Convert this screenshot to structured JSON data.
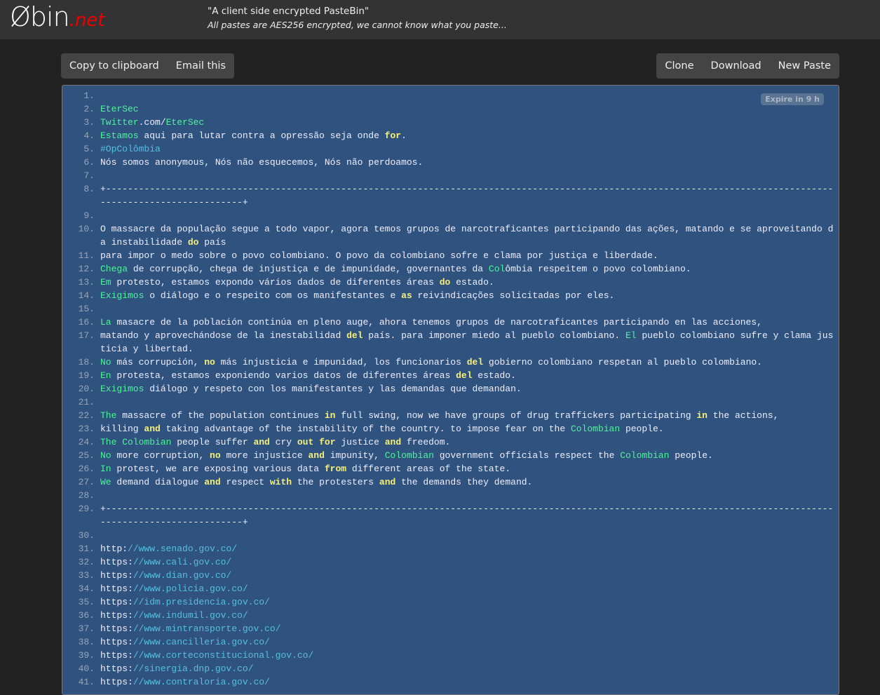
{
  "header": {
    "logo_main": "Øbin",
    "logo_tld": ".net",
    "tagline": "\"A client side encrypted PasteBin\"",
    "subtitle": "All pastes are AES256 encrypted, we cannot know what you paste..."
  },
  "toolbar_left": [
    "Copy to clipboard",
    "Email this"
  ],
  "toolbar_right": [
    "Clone",
    "Download",
    "New Paste"
  ],
  "paste": {
    "expire_badge": "Expire in 9 h",
    "lines": [
      [],
      [
        [
          "EterSec",
          "g"
        ]
      ],
      [
        [
          "Twitter",
          "g"
        ],
        [
          ".com/",
          ""
        ],
        [
          "EterSec",
          "g"
        ]
      ],
      [
        [
          "Estamos",
          "g"
        ],
        [
          " aqui para lutar contra a opressão seja onde ",
          ""
        ],
        [
          "for",
          "y"
        ],
        [
          ".",
          ""
        ]
      ],
      [
        [
          "#OpColômbia",
          "c"
        ]
      ],
      [
        [
          "Nós somos anonymous, Nós não esquecemos, Nós não perdoamos.",
          ""
        ]
      ],
      [],
      [
        [
          "+---------------------------------------------------------------------------------------------------------------------------------------------------------------+",
          ""
        ]
      ],
      [],
      [
        [
          "O massacre da população segue a todo vapor, agora temos grupos de narcotraficantes participando das ações, matando e se aproveitando da instabilidade ",
          ""
        ],
        [
          "do",
          "y"
        ],
        [
          " país",
          ""
        ]
      ],
      [
        [
          "para impor o medo sobre o povo colombiano. O povo da colombiano sofre e clama por justiça e liberdade.",
          ""
        ]
      ],
      [
        [
          "Chega",
          "g"
        ],
        [
          " de corrupção, chega de injustiça e de impunidade, governantes da ",
          ""
        ],
        [
          "Col",
          "g"
        ],
        [
          "ômbia respeitem o povo colombiano.",
          ""
        ]
      ],
      [
        [
          "Em",
          "g"
        ],
        [
          " protesto, estamos expondo vários dados de diferentes áreas ",
          ""
        ],
        [
          "do",
          "y"
        ],
        [
          " estado.",
          ""
        ]
      ],
      [
        [
          "Exigimos",
          "g"
        ],
        [
          " o diálogo e o respeito com os manifestantes e ",
          ""
        ],
        [
          "as",
          "y"
        ],
        [
          " reivindicações solicitadas por eles.",
          ""
        ]
      ],
      [],
      [
        [
          "La",
          "g"
        ],
        [
          " masacre de la población continúa en pleno auge, ahora tenemos grupos de narcotraficantes participando en las acciones,",
          ""
        ]
      ],
      [
        [
          "matando y aprovechándose de la inestabilidad ",
          ""
        ],
        [
          "del",
          "y"
        ],
        [
          " país. para imponer miedo al pueblo colombiano. ",
          ""
        ],
        [
          "El",
          "g"
        ],
        [
          " pueblo colombiano sufre y clama justicia y libertad.",
          ""
        ]
      ],
      [
        [
          "No",
          "g"
        ],
        [
          " más corrupción, ",
          ""
        ],
        [
          "no",
          "y"
        ],
        [
          " más injusticia e impunidad, los funcionarios ",
          ""
        ],
        [
          "del",
          "y"
        ],
        [
          " gobierno colombiano respetan al pueblo colombiano.",
          ""
        ]
      ],
      [
        [
          "En",
          "g"
        ],
        [
          " protesta, estamos exponiendo varios datos de diferentes áreas ",
          ""
        ],
        [
          "del",
          "y"
        ],
        [
          " estado.",
          ""
        ]
      ],
      [
        [
          "Exigimos",
          "g"
        ],
        [
          " diálogo y respeto con los manifestantes y las demandas que demandan.",
          ""
        ]
      ],
      [],
      [
        [
          "The",
          "g"
        ],
        [
          " massacre of the population continues ",
          ""
        ],
        [
          "in",
          "y"
        ],
        [
          " full swing, now we have groups of drug traffickers participating ",
          ""
        ],
        [
          "in",
          "y"
        ],
        [
          " the actions,",
          ""
        ]
      ],
      [
        [
          "killing ",
          ""
        ],
        [
          "and",
          "y"
        ],
        [
          " taking advantage of the instability of the country. to impose fear on the ",
          ""
        ],
        [
          "Colombian",
          "g"
        ],
        [
          " people.",
          ""
        ]
      ],
      [
        [
          "The Colombian",
          "g"
        ],
        [
          " people suffer ",
          ""
        ],
        [
          "and",
          "y"
        ],
        [
          " cry ",
          ""
        ],
        [
          "out",
          "y"
        ],
        [
          " ",
          ""
        ],
        [
          "for",
          "y"
        ],
        [
          " justice ",
          ""
        ],
        [
          "and",
          "y"
        ],
        [
          " freedom.",
          ""
        ]
      ],
      [
        [
          "No",
          "g"
        ],
        [
          " more corruption, ",
          ""
        ],
        [
          "no",
          "y"
        ],
        [
          " more injustice ",
          ""
        ],
        [
          "and",
          "y"
        ],
        [
          " impunity, ",
          ""
        ],
        [
          "Colombian",
          "g"
        ],
        [
          " government officials respect the ",
          ""
        ],
        [
          "Colombian",
          "g"
        ],
        [
          " people.",
          ""
        ]
      ],
      [
        [
          "In",
          "g"
        ],
        [
          " protest, we are exposing various data ",
          ""
        ],
        [
          "from",
          "y"
        ],
        [
          " different areas of the state.",
          ""
        ]
      ],
      [
        [
          "We",
          "g"
        ],
        [
          " demand dialogue ",
          ""
        ],
        [
          "and",
          "y"
        ],
        [
          " respect ",
          ""
        ],
        [
          "with",
          "y"
        ],
        [
          " the protesters ",
          ""
        ],
        [
          "and",
          "y"
        ],
        [
          " the demands they demand.",
          ""
        ]
      ],
      [],
      [
        [
          "+---------------------------------------------------------------------------------------------------------------------------------------------------------------+",
          ""
        ]
      ],
      [],
      [
        [
          "http:",
          ""
        ],
        [
          "//www.senado.gov.co/",
          "c"
        ]
      ],
      [
        [
          "https:",
          ""
        ],
        [
          "//www.cali.gov.co/",
          "c"
        ]
      ],
      [
        [
          "https:",
          ""
        ],
        [
          "//www.dian.gov.co/",
          "c"
        ]
      ],
      [
        [
          "https:",
          ""
        ],
        [
          "//www.policia.gov.co/",
          "c"
        ]
      ],
      [
        [
          "https:",
          ""
        ],
        [
          "//idm.presidencia.gov.co/",
          "c"
        ]
      ],
      [
        [
          "https:",
          ""
        ],
        [
          "//www.indumil.gov.co/",
          "c"
        ]
      ],
      [
        [
          "https:",
          ""
        ],
        [
          "//www.mintransporte.gov.co/",
          "c"
        ]
      ],
      [
        [
          "https:",
          ""
        ],
        [
          "//www.cancilleria.gov.co/",
          "c"
        ]
      ],
      [
        [
          "https:",
          ""
        ],
        [
          "//www.corteconstitucional.gov.co/",
          "c"
        ]
      ],
      [
        [
          "https:",
          ""
        ],
        [
          "//sinergia.dnp.gov.co/",
          "c"
        ]
      ],
      [
        [
          "https:",
          ""
        ],
        [
          "//www.contraloria.gov.co/",
          "c"
        ]
      ]
    ]
  },
  "colors": {
    "background": "#222222",
    "header": "#333333",
    "panel": "#30527f",
    "keyword_green": "#4ef39a",
    "keyword_yellow": "#f5f07a",
    "link_cyan": "#56bfe0",
    "logo_tld": "#ee0000"
  }
}
